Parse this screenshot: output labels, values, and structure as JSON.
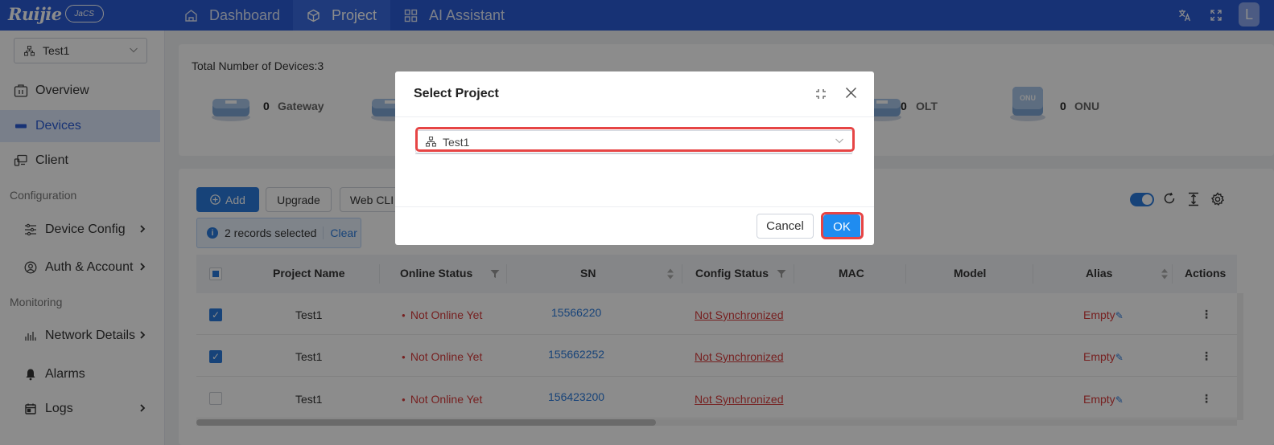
{
  "topbar": {
    "logo": "Ruijie",
    "logo_badge": "JaCS",
    "tabs": [
      {
        "label": "Dashboard",
        "icon": "home-icon"
      },
      {
        "label": "Project",
        "icon": "cube-icon"
      },
      {
        "label": "AI Assistant",
        "icon": "grid-icon"
      }
    ],
    "avatar_letter": "L"
  },
  "sidebar": {
    "project": "Test1",
    "items": [
      {
        "label": "Overview"
      },
      {
        "label": "Devices"
      },
      {
        "label": "Client"
      }
    ],
    "section_config": "Configuration",
    "config_items": [
      {
        "label": "Device Config"
      },
      {
        "label": "Auth & Account"
      }
    ],
    "section_monitoring": "Monitoring",
    "monitoring_items": [
      {
        "label": "Network Details"
      },
      {
        "label": "Alarms"
      },
      {
        "label": "Logs"
      }
    ]
  },
  "overview": {
    "total_label": "Total Number of Devices:3",
    "devices": [
      {
        "count": "0",
        "name": "Gateway"
      },
      {
        "count": "0",
        "name": "OLT"
      },
      {
        "count": "0",
        "name": "ONU"
      }
    ]
  },
  "toolbar": {
    "add": "Add",
    "upgrade": "Upgrade",
    "webcli": "Web CLI"
  },
  "selection": {
    "text": "2 records selected",
    "clear": "Clear"
  },
  "table": {
    "headers": {
      "project": "Project Name",
      "online": "Online Status",
      "sn": "SN",
      "config": "Config Status",
      "mac": "MAC",
      "model": "Model",
      "alias": "Alias",
      "actions": "Actions"
    },
    "rows": [
      {
        "project": "Test1",
        "online": "Not Online Yet",
        "sn": "15566220",
        "config": "Not Synchronized",
        "alias": "Empty",
        "checked": true
      },
      {
        "project": "Test1",
        "online": "Not Online Yet",
        "sn": "155662252",
        "config": "Not Synchronized",
        "alias": "Empty",
        "checked": true
      },
      {
        "project": "Test1",
        "online": "Not Online Yet",
        "sn": "156423200",
        "config": "Not Synchronized",
        "alias": "Empty",
        "checked": false
      }
    ]
  },
  "modal": {
    "title": "Select Project",
    "selected_project": "Test1",
    "cancel": "Cancel",
    "ok": "OK"
  },
  "colors": {
    "brand": "#2b5cd6",
    "primary": "#2b7bdc",
    "danger": "#d83b3b",
    "highlight": "#e64545"
  }
}
